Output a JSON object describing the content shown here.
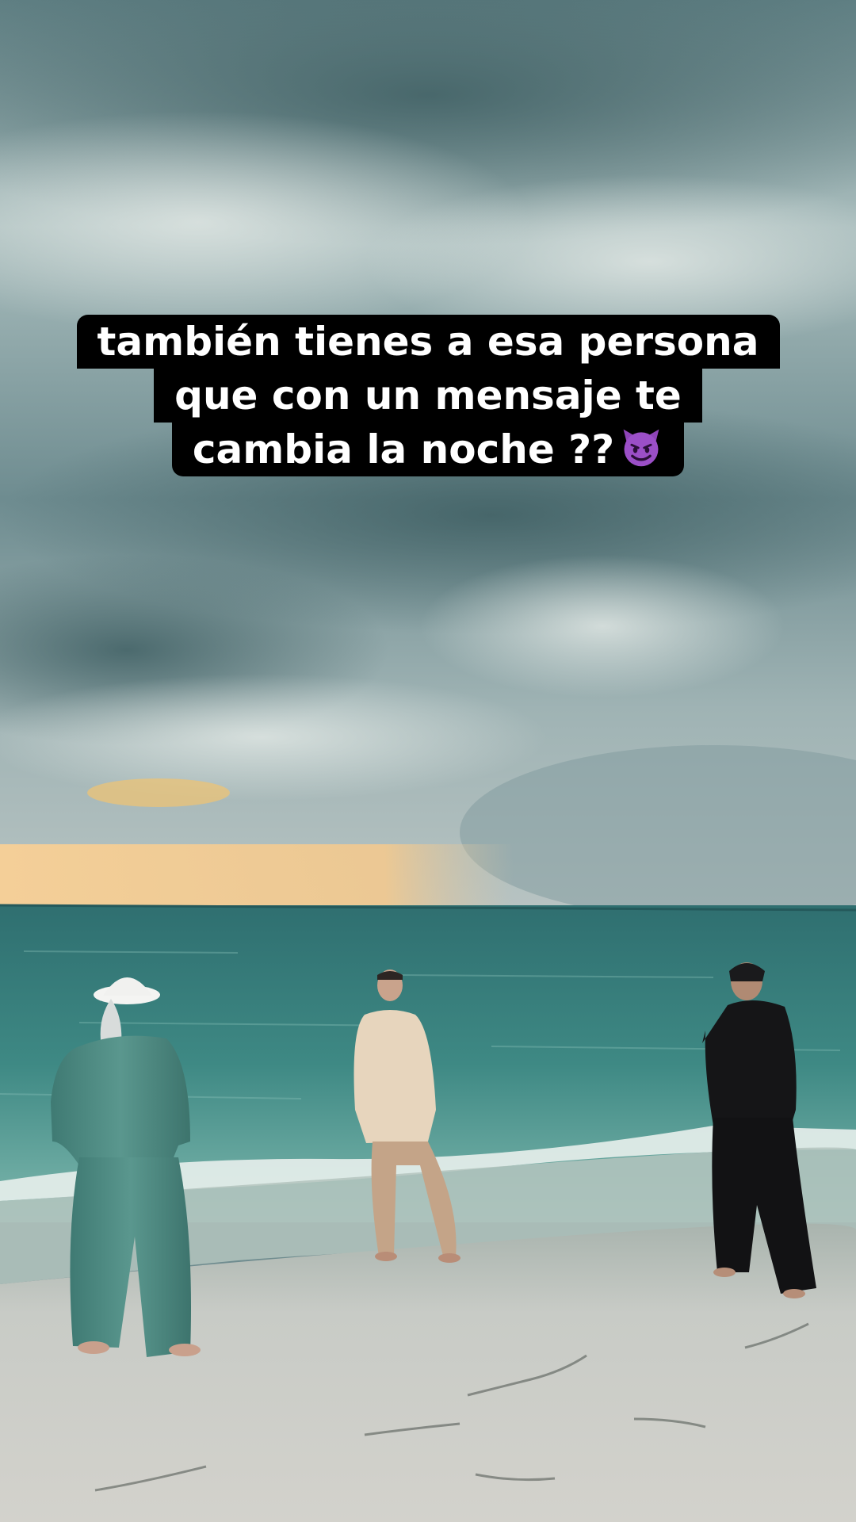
{
  "caption": {
    "lines": [
      "también tienes a esa persona",
      "que con un mensaje te",
      "cambia la noche ??"
    ],
    "emoji_icon": "smiling-devil-emoji-icon"
  },
  "scene": {
    "description_colors": {
      "sky": "#8fa9ab",
      "clouds_dark": "#4f6e72",
      "sunset": "#f2c48a",
      "sea": "#3f8a86",
      "sand": "#c9cbc6",
      "suit_green": "#4f8a82",
      "suit_beige": "#e3cfb4",
      "outfit_black": "#141416"
    }
  }
}
